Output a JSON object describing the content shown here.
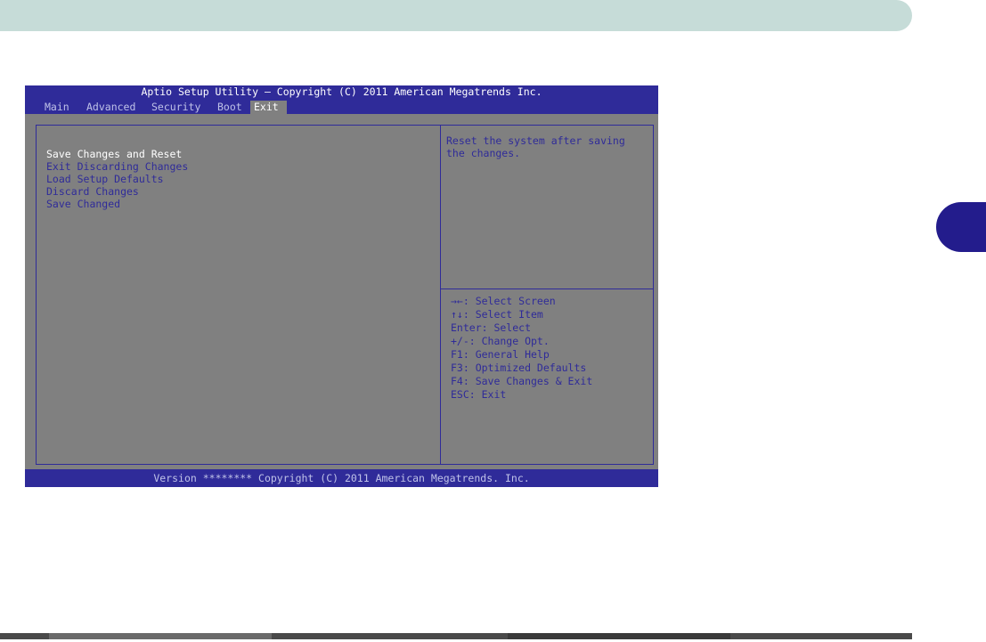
{
  "bios": {
    "title": "Aptio Setup Utility – Copyright (C) 2011 American Megatrends Inc.",
    "tabs": [
      {
        "label": "Main",
        "active": false
      },
      {
        "label": "Advanced",
        "active": false
      },
      {
        "label": "Security",
        "active": false
      },
      {
        "label": "Boot",
        "active": false
      },
      {
        "label": "Exit",
        "active": true
      }
    ],
    "menu_items": [
      {
        "label": "Save Changes and Reset",
        "selected": true
      },
      {
        "label": "Exit Discarding Changes",
        "selected": false
      },
      {
        "label": "Load Setup Defaults",
        "selected": false
      },
      {
        "label": "Discard Changes",
        "selected": false
      },
      {
        "label": "Save Changed",
        "selected": false
      }
    ],
    "help_lines": [
      "Reset the system after saving",
      "the changes."
    ],
    "keys": [
      "→←: Select Screen",
      "↑↓: Select Item",
      "Enter: Select",
      "+/-: Change Opt.",
      "F1: General Help",
      "F3: Optimized Defaults",
      "F4: Save Changes & Exit",
      "ESC: Exit"
    ],
    "footer": "Version ******** Copyright (C) 2011 American Megatrends. Inc."
  },
  "colors": {
    "bios_blue": "#2f2b99",
    "bios_gray": "#808080",
    "top_bar": "#c6dcd8",
    "chapter_tab": "#231c8c"
  }
}
